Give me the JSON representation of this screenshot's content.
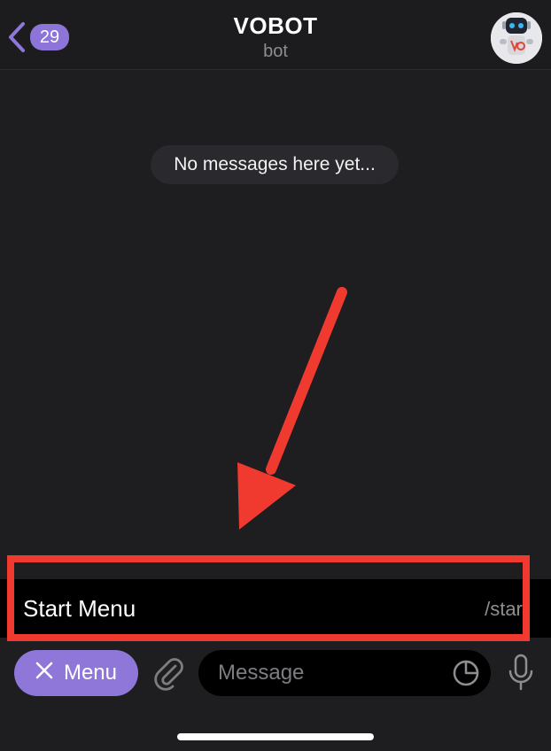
{
  "header": {
    "back_count": "29",
    "title": "VOBOT",
    "subtitle": "bot"
  },
  "chat": {
    "empty_text": "No messages here yet..."
  },
  "commands": [
    {
      "name": "Start Menu",
      "command": "/start"
    }
  ],
  "input": {
    "menu_label": "Menu",
    "placeholder": "Message"
  },
  "annotation": {
    "color": "#f13a2f"
  },
  "colors": {
    "accent": "#8f77d9",
    "background": "#1e1d20"
  },
  "icons": [
    "chevron-left-icon",
    "close-icon",
    "paperclip-icon",
    "sticker-icon",
    "microphone-icon",
    "bot-avatar"
  ]
}
